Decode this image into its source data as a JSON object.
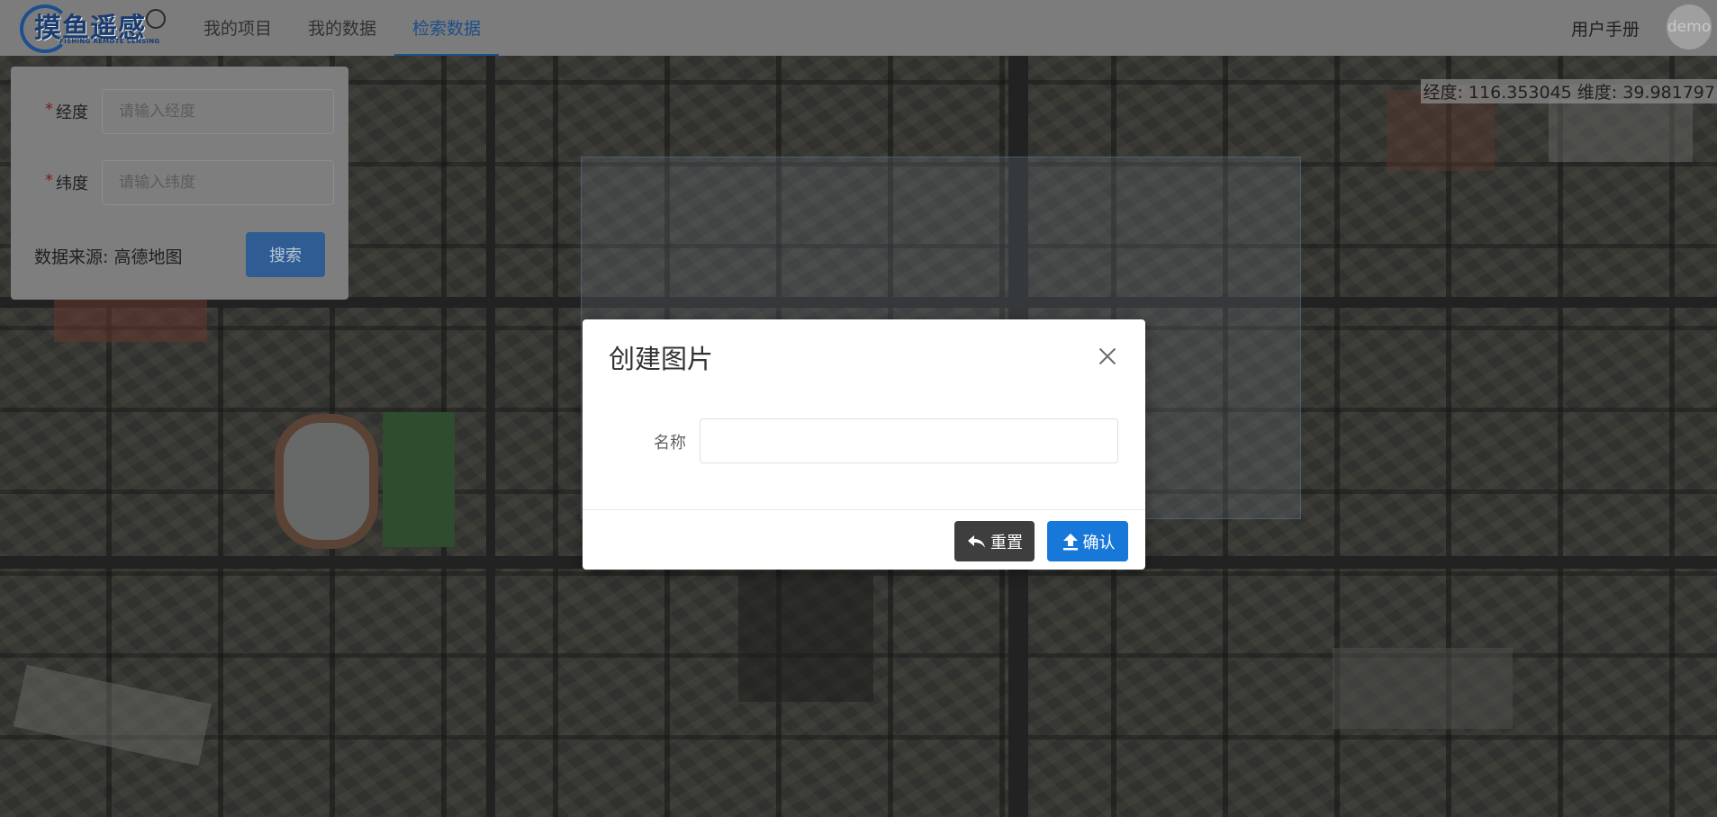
{
  "app": {
    "logo_text": "摸鱼遥感",
    "logo_subtitle": "FISHING REMOTE SENSING"
  },
  "nav": {
    "items": [
      {
        "label": "我的项目"
      },
      {
        "label": "我的数据"
      },
      {
        "label": "检索数据",
        "active": true
      }
    ],
    "manual_label": "用户手册",
    "avatar_text": "demo"
  },
  "map": {
    "coord_readout": "经度: 116.353045 维度: 39.981797"
  },
  "search_form": {
    "longitude_label": "经度",
    "longitude_placeholder": "请输入经度",
    "latitude_label": "纬度",
    "latitude_placeholder": "请输入纬度",
    "required_mark": "*",
    "source_text": "数据来源: 高德地图",
    "search_label": "搜索"
  },
  "modal": {
    "title": "创建图片",
    "name_label": "名称",
    "name_value": "",
    "reset_label": "重置",
    "confirm_label": "确认"
  },
  "colors": {
    "accent": "#1878d9",
    "nav_active": "#1d4f88",
    "reset_button": "#3e3e3e"
  },
  "icons": {
    "close": "close-icon",
    "reset": "undo-icon",
    "confirm": "upload-icon"
  }
}
